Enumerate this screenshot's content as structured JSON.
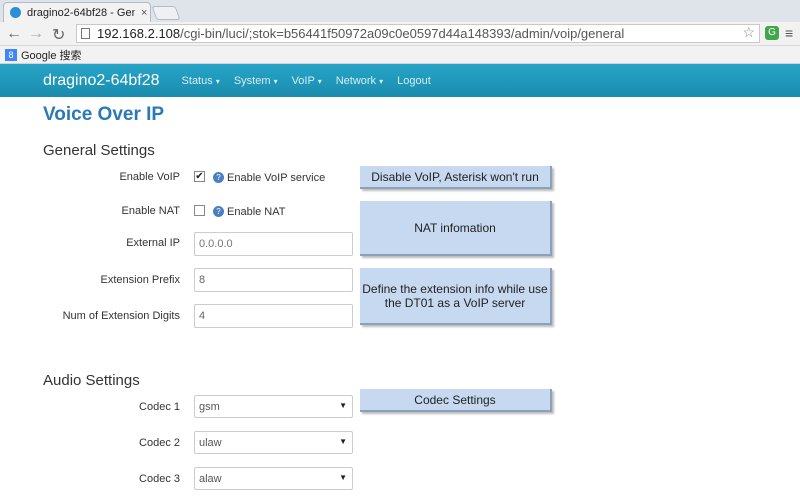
{
  "browser": {
    "tab_title": "dragino2-64bf28 - Gen",
    "tab_close": "×",
    "url_host": "192.168.2.108",
    "url_path": "/cgi-bin/luci/;stok=b56441f50972a09c0e0597d44a148393/admin/voip/general",
    "back_glyph": "←",
    "forward_glyph": "→",
    "reload_glyph": "↻",
    "bookmark_label": "Google 搜索",
    "extension_glyph": "G",
    "menu_glyph": "≡"
  },
  "header": {
    "brand": "dragino2-64bf28",
    "menus": [
      "Status",
      "System",
      "VoIP",
      "Network"
    ],
    "logout": "Logout",
    "caret": "▾"
  },
  "page": {
    "title": "Voice Over IP",
    "general_title": "General Settings",
    "audio_title": "Audio Settings"
  },
  "general": {
    "enable_voip_label": "Enable VoIP",
    "enable_voip_checked": "✔",
    "enable_voip_help": "Enable VoIP service",
    "enable_nat_label": "Enable NAT",
    "enable_nat_help": "Enable NAT",
    "external_ip_label": "External IP",
    "external_ip_placeholder": "0.0.0.0",
    "extension_prefix_label": "Extension Prefix",
    "extension_prefix_value": "8",
    "num_digits_label": "Num of Extension Digits",
    "num_digits_value": "4",
    "help_glyph": "?"
  },
  "audio": {
    "codec1_label": "Codec 1",
    "codec1_value": "gsm",
    "codec2_label": "Codec 2",
    "codec2_value": "ulaw",
    "codec3_label": "Codec 3",
    "codec3_value": "alaw",
    "arrow_glyph": "▼"
  },
  "annotations": {
    "voip_note": "Disable VoIP, Asterisk won't run",
    "nat_note": "NAT infomation",
    "ext_note_line1": "Define the extension info while use",
    "ext_note_line2": "the DT01 as  a VoIP server",
    "codec_note": "Codec Settings"
  }
}
